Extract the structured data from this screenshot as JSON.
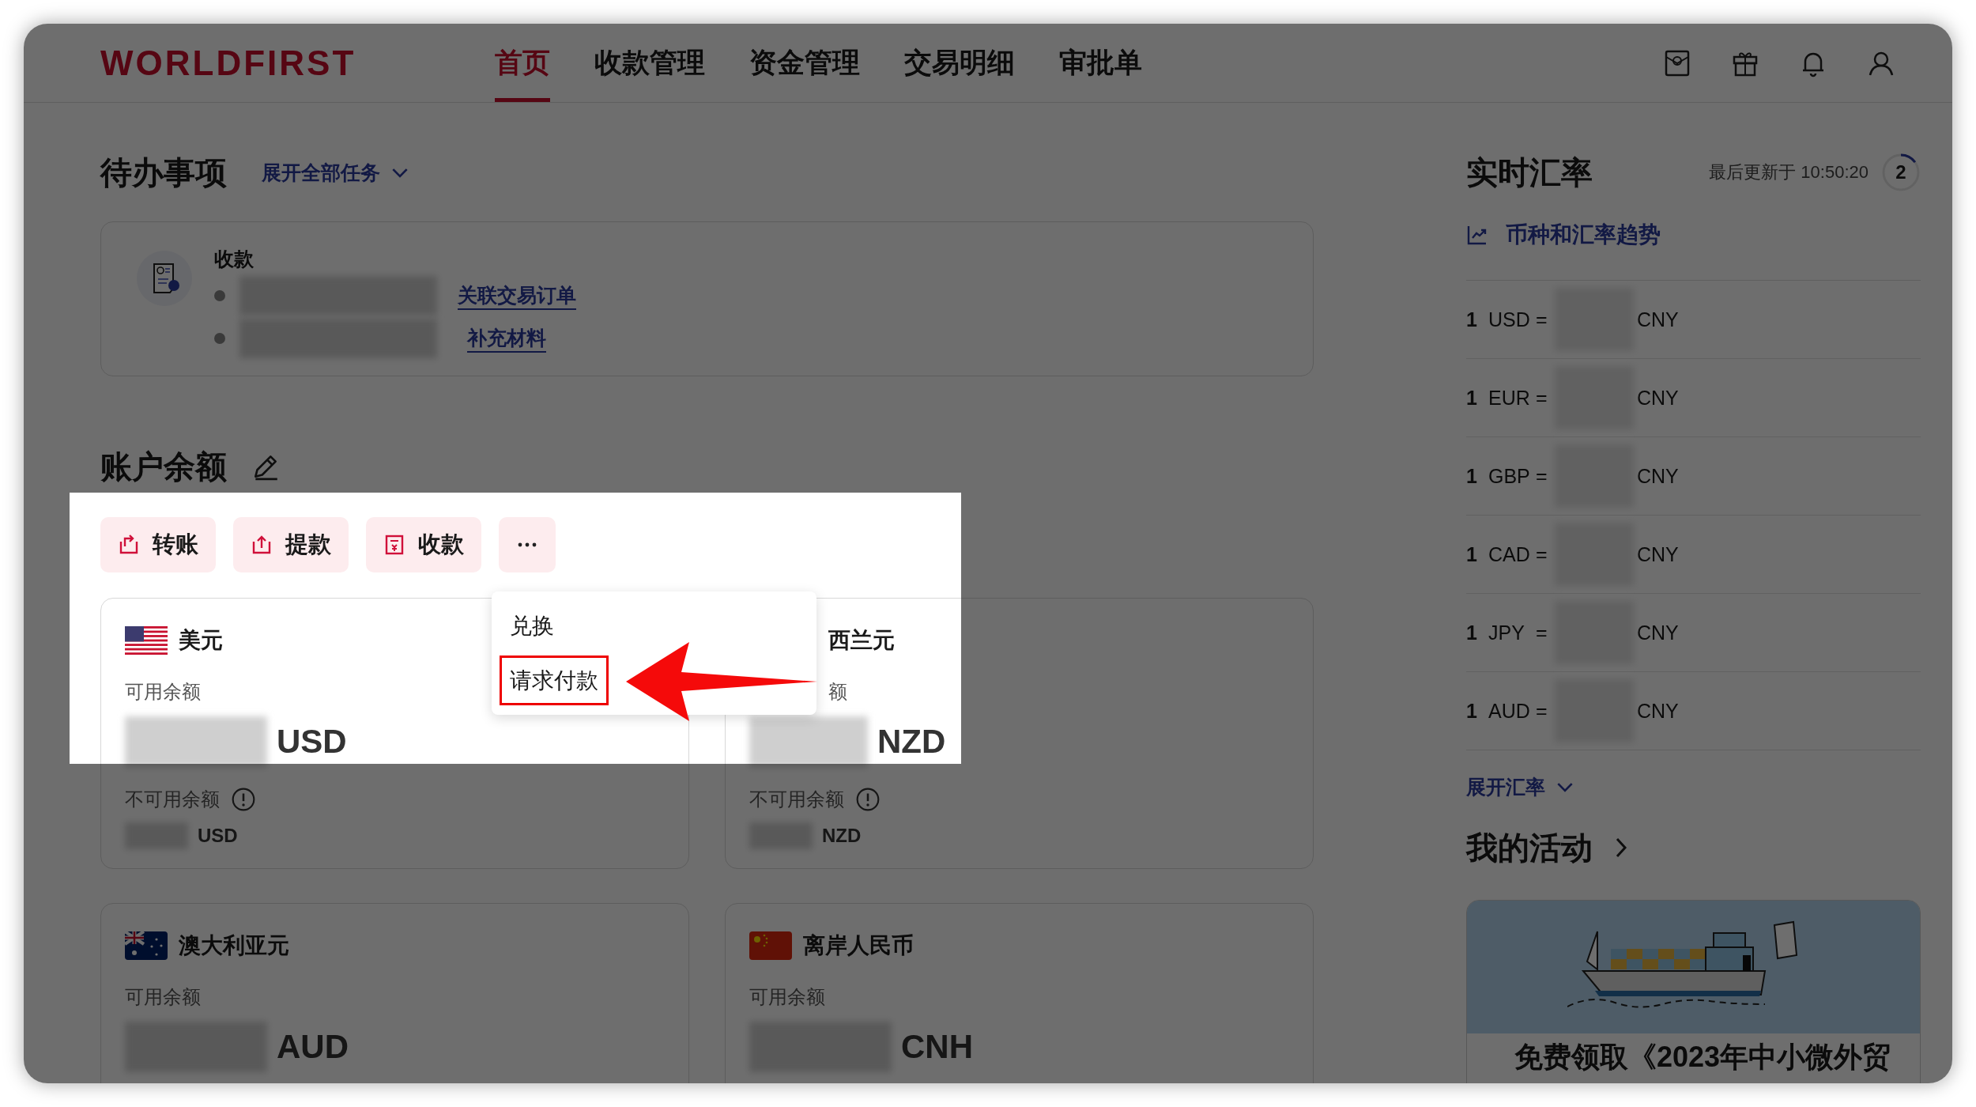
{
  "logo": "WORLDFIRST",
  "nav": [
    {
      "label": "首页",
      "selected": true
    },
    {
      "label": "收款管理",
      "selected": false
    },
    {
      "label": "资金管理",
      "selected": false
    },
    {
      "label": "交易明细",
      "selected": false
    },
    {
      "label": "审批单",
      "selected": false
    }
  ],
  "todo": {
    "title": "待办事项",
    "expand_link": "展开全部任务",
    "card_title": "收款",
    "items": [
      {
        "link": "关联交易订单"
      },
      {
        "link": "补充材料"
      }
    ]
  },
  "balance": {
    "title": "账户余额",
    "actions": [
      {
        "label": "转账",
        "kind": "transfer"
      },
      {
        "label": "提款",
        "kind": "withdraw"
      },
      {
        "label": "收款",
        "kind": "receive"
      }
    ],
    "menu": [
      {
        "label": "兑换",
        "highlighted": false
      },
      {
        "label": "请求付款",
        "highlighted": true
      }
    ],
    "cards": [
      {
        "kind": "us",
        "name": "美元",
        "available_label": "可用余额",
        "currency": "USD",
        "unavailable_label": "不可用余额",
        "unavailable_currency": "USD",
        "covered": false
      },
      {
        "name": "西兰元",
        "available_label": "额",
        "currency": "NZD",
        "unavailable_label": "不可用余额",
        "unavailable_currency": "NZD",
        "covered": true
      },
      {
        "kind": "au",
        "name": "澳大利亚元",
        "available_label": "可用余额",
        "currency": "AUD",
        "covered": false
      },
      {
        "kind": "cn",
        "name": "离岸人民币",
        "available_label": "可用余额",
        "currency": "CNH",
        "covered": false
      }
    ]
  },
  "rates": {
    "title": "实时汇率",
    "updated": "最后更新于 10:50:20",
    "countdown": "2",
    "level": 0.15,
    "trend_link": "币种和汇率趋势",
    "rows": [
      {
        "amount": "1",
        "from": "USD",
        "eq": "=",
        "to": "CNY"
      },
      {
        "amount": "1",
        "from": "EUR",
        "eq": "=",
        "to": "CNY"
      },
      {
        "amount": "1",
        "from": "GBP",
        "eq": "=",
        "to": "CNY"
      },
      {
        "amount": "1",
        "from": "CAD",
        "eq": "=",
        "to": "CNY"
      },
      {
        "amount": "1",
        "from": "JPY",
        "eq": "=",
        "to": "CNY"
      },
      {
        "amount": "1",
        "from": "AUD",
        "eq": "=",
        "to": "CNY"
      }
    ],
    "expand_link": "展开汇率"
  },
  "activity": {
    "title": "我的活动",
    "card_title": "免费领取《2023年中小微外贸"
  }
}
